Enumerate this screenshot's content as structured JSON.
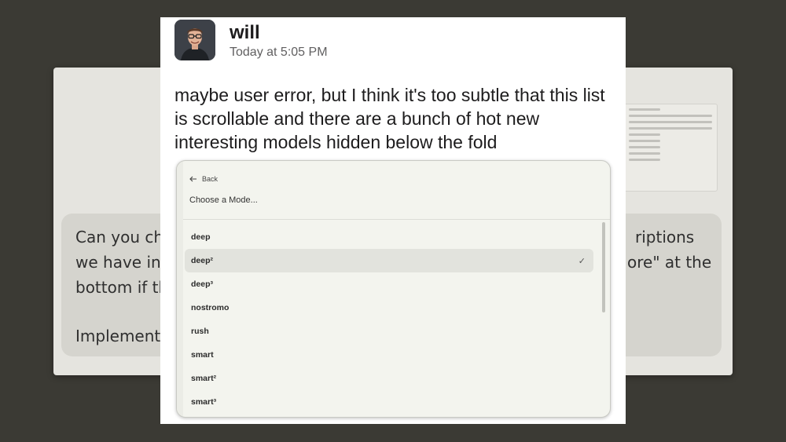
{
  "message": {
    "author": "will",
    "timestamp": "Today at 5:05 PM",
    "text": "maybe user error, but I think it's too subtle that this list is scrollable and there are a bunch of hot new interesting models hidden below the fold"
  },
  "background_request": {
    "line1_left": "Can you ch",
    "line1_right": "riptions",
    "line2_left": "we have in",
    "line2_right": "ore\" at the",
    "line3_left": "bottom if th",
    "line4_left": "Implement"
  },
  "mode_picker": {
    "back_label": "Back",
    "title": "Choose a Mode...",
    "items": [
      {
        "label": "deep",
        "selected": false
      },
      {
        "label": "deep²",
        "selected": true
      },
      {
        "label": "deep³",
        "selected": false
      },
      {
        "label": "nostromo",
        "selected": false
      },
      {
        "label": "rush",
        "selected": false
      },
      {
        "label": "smart",
        "selected": false
      },
      {
        "label": "smart²",
        "selected": false
      },
      {
        "label": "smart³",
        "selected": false
      }
    ]
  },
  "icons": {
    "back": "arrow-left-icon",
    "selected": "check-icon"
  },
  "colors": {
    "backdrop": "#3b3a34",
    "card": "#ffffff",
    "picker_bg": "#f3f4ee",
    "selected_row": "#e2e3dd"
  }
}
